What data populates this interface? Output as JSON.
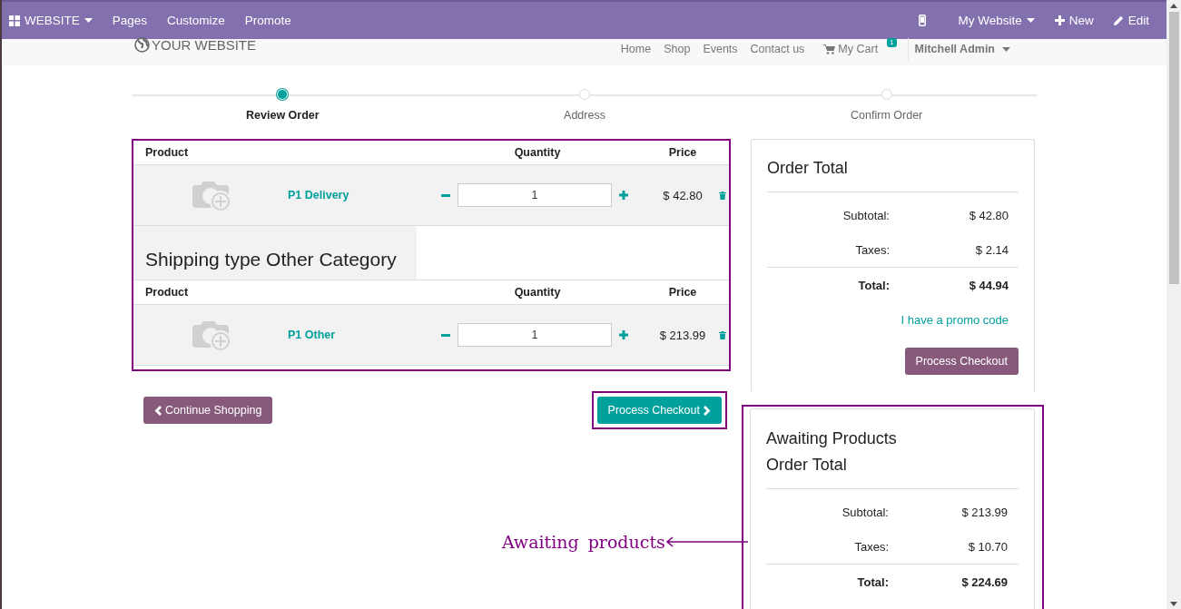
{
  "topbar": {
    "app_menu": "WEBSITE",
    "items": [
      "Pages",
      "Customize",
      "Promote"
    ],
    "site_menu": "My Website",
    "new": "New",
    "edit": "Edit"
  },
  "header": {
    "logo": "YOUR WEBSITE",
    "nav": [
      "Home",
      "Shop",
      "Events",
      "Contact us"
    ],
    "cart": "My Cart",
    "cart_count": "1",
    "user": "Mitchell Admin"
  },
  "steps": [
    {
      "label": "Review Order",
      "selected": true
    },
    {
      "label": "Address",
      "selected": false
    },
    {
      "label": "Confirm Order",
      "selected": false
    }
  ],
  "cart_sections": [
    {
      "columns": [
        "Product",
        "Quantity",
        "Price"
      ],
      "rows": [
        {
          "name": "P1 Delivery",
          "quantity": "1",
          "price": "$ 42.80"
        }
      ]
    },
    {
      "title": "Shipping type Other Category",
      "columns": [
        "Product",
        "Quantity",
        "Price"
      ],
      "rows": [
        {
          "name": "P1 Other",
          "quantity": "1",
          "price": "$ 213.99"
        }
      ]
    }
  ],
  "continue_button": "Continue Shopping",
  "checkout_button": "Process Checkout",
  "order_total": {
    "title": "Order Total",
    "lines": [
      {
        "label": "Subtotal:",
        "value": "$ 42.80",
        "kind": "amount"
      },
      {
        "label": "Taxes:",
        "value": "$ 2.14",
        "kind": "amount"
      },
      {
        "label": "Total:",
        "value": "$ 44.94",
        "kind": "total"
      }
    ],
    "promo": "I have a promo code",
    "checkout": "Process Checkout"
  },
  "awaiting_total": {
    "title": "Awaiting Products",
    "subtitle": "Order Total",
    "lines": [
      {
        "label": "Subtotal:",
        "value": "$ 213.99",
        "kind": "amount"
      },
      {
        "label": "Taxes:",
        "value": "$ 10.70",
        "kind": "amount"
      },
      {
        "label": "Total:",
        "value": "$ 224.69",
        "kind": "total"
      }
    ]
  },
  "annotation": {
    "text": "Awaiting products"
  }
}
